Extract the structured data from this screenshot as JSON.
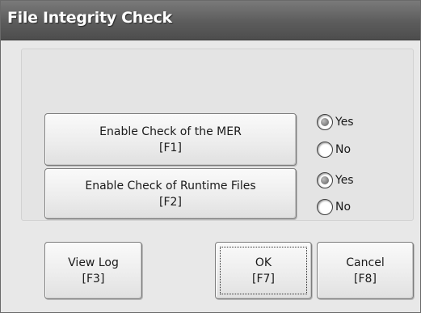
{
  "window": {
    "title": "File Integrity Check"
  },
  "mer_check": {
    "button_line1": "Enable Check of the MER",
    "button_line2": "[F1]",
    "yes_label": "Yes",
    "no_label": "No",
    "selected": "Yes"
  },
  "runtime_check": {
    "button_line1": "Enable Check of Runtime Files",
    "button_line2": "[F2]",
    "yes_label": "Yes",
    "no_label": "No",
    "selected": "Yes"
  },
  "footer": {
    "view_log_line1": "View Log",
    "view_log_line2": "[F3]",
    "ok_line1": "OK",
    "ok_line2": "[F7]",
    "cancel_line1": "Cancel",
    "cancel_line2": "[F8]"
  },
  "colors": {
    "titlebar": "#5c5c5c",
    "title_text": "#ffffff",
    "dialog_background": "#e8e8e8",
    "button_face": "#ededed",
    "radio_selected_dot": "#7a7a7a"
  },
  "icons": {
    "radio_selected": "radio-selected-icon",
    "radio_unselected": "radio-unselected-icon"
  }
}
